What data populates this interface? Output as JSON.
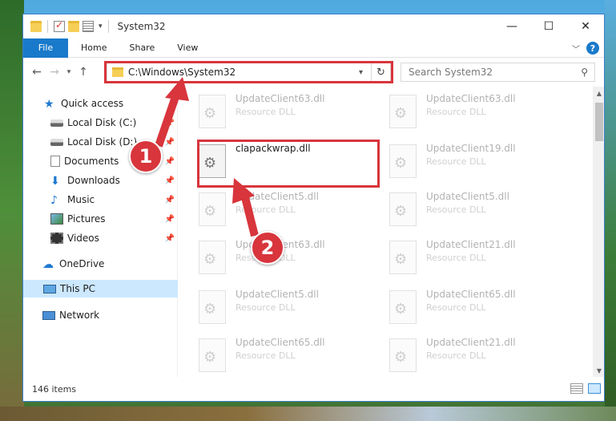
{
  "window": {
    "title": "System32",
    "qat_dropdown": "▾",
    "controls": {
      "minimize": "—",
      "maximize": "☐",
      "close": "✕"
    }
  },
  "ribbon": {
    "tabs": [
      "File",
      "Home",
      "Share",
      "View"
    ],
    "expand_icon": "chevron-down-icon",
    "help_label": "?"
  },
  "navigation": {
    "back": "←",
    "forward": "→",
    "recent": "▾",
    "up": "↑",
    "address_path": "C:\\Windows\\System32",
    "address_dropdown": "▾",
    "refresh": "↻",
    "search_placeholder": "Search System32",
    "search_icon": "⚲"
  },
  "sidebar": {
    "items": [
      {
        "label": "Quick access",
        "icon": "star-icon",
        "glyph": "★",
        "pinned": false
      },
      {
        "label": "Local Disk (C:)",
        "icon": "disk-icon",
        "glyph": "",
        "pinned": true
      },
      {
        "label": "Local Disk (D:)",
        "icon": "disk-icon",
        "glyph": "",
        "pinned": true
      },
      {
        "label": "Documents",
        "icon": "documents-icon",
        "glyph": "",
        "pinned": true
      },
      {
        "label": "Downloads",
        "icon": "download-icon",
        "glyph": "⬇",
        "pinned": true
      },
      {
        "label": "Music",
        "icon": "music-icon",
        "glyph": "♪",
        "pinned": true
      },
      {
        "label": "Pictures",
        "icon": "pictures-icon",
        "glyph": "",
        "pinned": true
      },
      {
        "label": "Videos",
        "icon": "videos-icon",
        "glyph": "",
        "pinned": true
      },
      {
        "label": "OneDrive",
        "icon": "cloud-icon",
        "glyph": "☁",
        "pinned": false
      },
      {
        "label": "This PC",
        "icon": "computer-icon",
        "glyph": "",
        "pinned": false,
        "selected": true
      },
      {
        "label": "Network",
        "icon": "network-icon",
        "glyph": "",
        "pinned": false
      }
    ],
    "pin_glyph": "📌"
  },
  "files": [
    {
      "name": "UpdateClient63.dll",
      "type": "Resource DLL",
      "active": false
    },
    {
      "name": "UpdateClient63.dll",
      "type": "Resource DLL",
      "active": false
    },
    {
      "name": "clapackwrap.dll",
      "type": "",
      "active": true
    },
    {
      "name": "UpdateClient19.dll",
      "type": "Resource DLL",
      "active": false
    },
    {
      "name": "UpdateClient5.dll",
      "type": "Resource DLL",
      "active": false
    },
    {
      "name": "UpdateClient5.dll",
      "type": "Resource DLL",
      "active": false
    },
    {
      "name": "UpdateClient63.dll",
      "type": "Resource DLL",
      "active": false
    },
    {
      "name": "UpdateClient21.dll",
      "type": "Resource DLL",
      "active": false
    },
    {
      "name": "UpdateClient5.dll",
      "type": "Resource DLL",
      "active": false
    },
    {
      "name": "UpdateClient65.dll",
      "type": "Resource DLL",
      "active": false
    },
    {
      "name": "UpdateClient65.dll",
      "type": "Resource DLL",
      "active": false
    },
    {
      "name": "UpdateClient21.dll",
      "type": "Resource DLL",
      "active": false
    }
  ],
  "status": {
    "item_count": "146 items"
  },
  "annotations": {
    "step1": "1",
    "step2": "2",
    "color": "#d8353c"
  }
}
